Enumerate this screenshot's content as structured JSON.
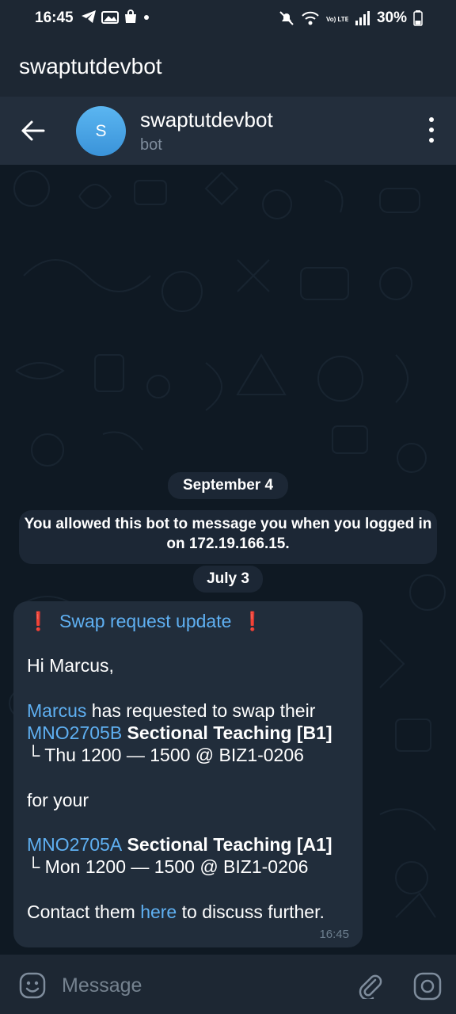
{
  "status_bar": {
    "time": "16:45",
    "left_icons": [
      "telegram-icon",
      "photos-icon",
      "shopping-bag-icon",
      "dot-icon"
    ],
    "right_icons": [
      "mute-icon",
      "wifi-icon",
      "volte-icon",
      "signal-icon"
    ],
    "volte_label": "Vo) LTE1",
    "battery": "30%"
  },
  "app_bar": {
    "title": "swaptutdevbot"
  },
  "chat_header": {
    "avatar_letter": "S",
    "name": "swaptutdevbot",
    "subtitle": "bot",
    "avatar_color": "#4ea7e6"
  },
  "messages": {
    "date_1": "September 4",
    "system_message": "You allowed this bot to message you when you logged in on 172.19.166.15.",
    "date_2": "July 3",
    "bubble": {
      "excl_left": "❗",
      "title": "Swap request update",
      "excl_right": "❗",
      "greeting": "Hi Marcus,",
      "requester": "Marcus",
      "request_text": " has requested to swap their",
      "their_code": "MNO2705B",
      "their_class": " Sectional Teaching [B1]",
      "their_slot": "└ Thu 1200 — 1500 @ BIZ1-0206",
      "for_your": "for your",
      "your_code": "MNO2705A",
      "your_class": " Sectional Teaching [A1]",
      "your_slot": "└ Mon 1200 — 1500 @ BIZ1-0206",
      "contact_prefix": "Contact them ",
      "contact_link": "here",
      "contact_suffix": " to discuss further.",
      "time": "16:45"
    }
  },
  "input_bar": {
    "placeholder": "Message"
  },
  "colors": {
    "accent_link": "#5fb0f2",
    "bubble_bg": "#212d3b",
    "header_bg": "#232e3c",
    "chat_bg": "#0f1923"
  }
}
